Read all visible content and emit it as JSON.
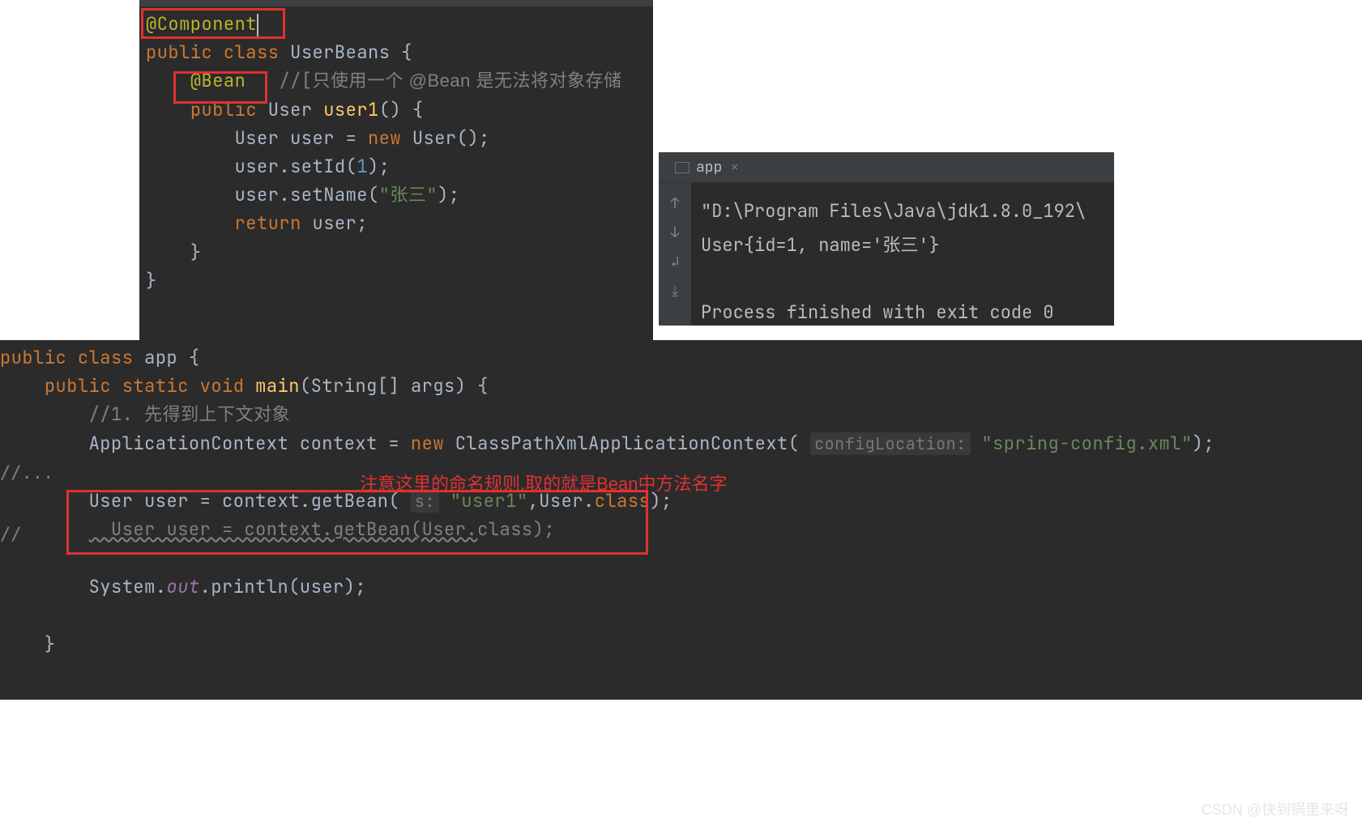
{
  "topPane": {
    "lines": {
      "annoComponent": "@Component",
      "classDecl1": "public",
      "classDecl2": "class",
      "classDecl3": "UserBeans {",
      "annoBean": "@Bean",
      "beanCommentPrefix": "//[",
      "beanCommentBody": "只使用一个 @Bean 是无法将对象存储",
      "m_public": "public",
      "m_ret": "User",
      "m_name": "user1",
      "m_sig": "() {",
      "l1a": "User user = ",
      "l1_new": "new",
      "l1b": " User();",
      "l2a": "user.setId(",
      "l2_num": "1",
      "l2b": ");",
      "l3a": "user.setName(",
      "l3_str": "\"张三\"",
      "l3b": ");",
      "l4_ret": "return",
      "l4_b": " user;",
      "brace1": "}",
      "brace2": "}"
    }
  },
  "bottomPane": {
    "classDecl1": "public",
    "classDecl2": "class",
    "classDecl3": "app {",
    "m_public": "public",
    "m_static": "static",
    "m_void": "void",
    "m_name": "main",
    "m_params": "(String[] args) {",
    "c1_slashes": "//1. ",
    "c1_body": "先得到上下文对象",
    "ctx1": "ApplicationContext context = ",
    "ctx_new": "new",
    "ctx2": " ClassPathXmlApplicationContext(",
    "ctx_hint": "configLocation:",
    "ctx_str": "\"spring-config.xml\"",
    "ctx3": ");",
    "gb1a": "User user = context.getBean(",
    "gb1_hint": "s:",
    "gb1_str": "\"user1\"",
    "gb1b": ",User.",
    "gb1_kw": "class",
    "gb1c": ");",
    "gb2a": "  User user = context.getBean(User.",
    "gb2_kw": "class",
    "gb2b": ");",
    "pr1": "System.",
    "pr_out": "out",
    "pr2": ".println(user);",
    "brace1": "}",
    "commentEllipsis": "//...",
    "commentSlash": "//",
    "redNote": "注意这里的命名规则,取的就是Bean中方法名字"
  },
  "console": {
    "tab": "app",
    "line1": "\"D:\\Program Files\\Java\\jdk1.8.0_192\\",
    "line2": "User{id=1, name='张三'}",
    "line3": "Process finished with exit code 0"
  },
  "watermark": "CSDN @快到锅里来呀"
}
